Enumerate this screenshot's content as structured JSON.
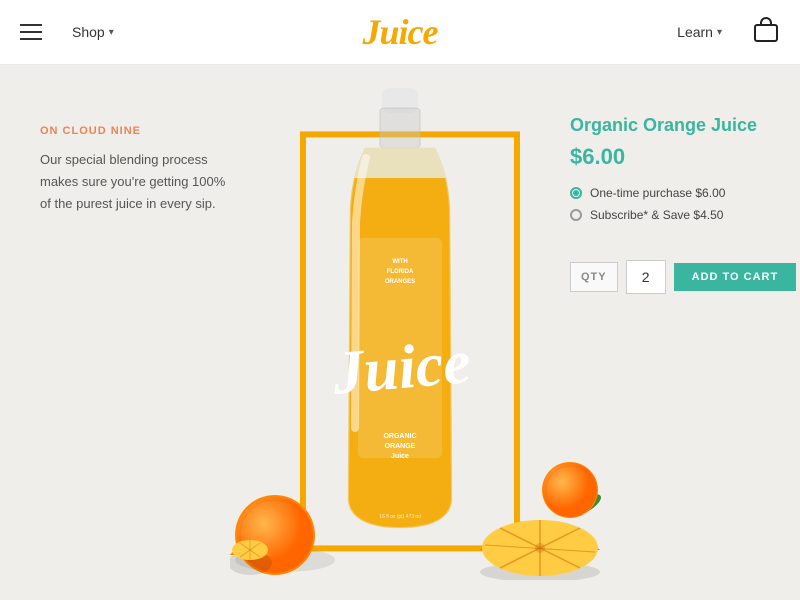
{
  "header": {
    "logo": "Juice",
    "nav_shop": "Shop",
    "nav_learn": "Learn",
    "cart_label": "Cart"
  },
  "left_panel": {
    "tagline": "ON CLOUD NINE",
    "description": "Our special blending process makes sure you're getting 100% of the purest juice in every sip."
  },
  "product": {
    "title": "Organic Orange Juice",
    "price": "$6.00",
    "option_one_time": "One-time purchase $6.00",
    "option_subscribe": "Subscribe* & Save $4.50",
    "qty_label": "QTY",
    "qty_value": "2",
    "add_to_cart": "ADD TO CART"
  },
  "bottle": {
    "label_line1": "WITH",
    "label_line2": "FLORIDA",
    "label_line3": "ORANGES",
    "brand": "Juice",
    "sub1": "ORGANIC",
    "sub2": "ORANGE",
    "sub3": "Juice",
    "volume": "16 fl oz (pt) 473 ml"
  }
}
